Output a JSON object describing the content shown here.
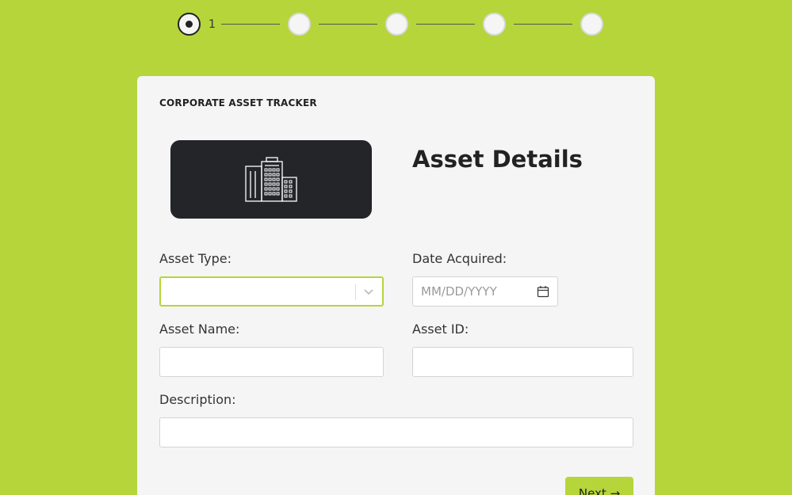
{
  "stepper": {
    "current_step_label": "1"
  },
  "form": {
    "eyebrow": "CORPORATE ASSET TRACKER",
    "title": "Asset Details",
    "asset_type": {
      "label": "Asset Type:",
      "value": ""
    },
    "date_acquired": {
      "label": "Date Acquired:",
      "placeholder": "MM/DD/YYYY"
    },
    "asset_name": {
      "label": "Asset Name:",
      "value": ""
    },
    "asset_id": {
      "label": "Asset ID:",
      "value": ""
    },
    "description": {
      "label": "Description:",
      "value": ""
    },
    "next_label": "Next →"
  },
  "colors": {
    "background": "#b5d53a",
    "card": "#f5f5f5",
    "hero": "#232529",
    "accent": "#b5d53a"
  },
  "icons": {
    "hero": "office-building-icon",
    "select": "chevron-down-icon",
    "date": "calendar-icon"
  }
}
